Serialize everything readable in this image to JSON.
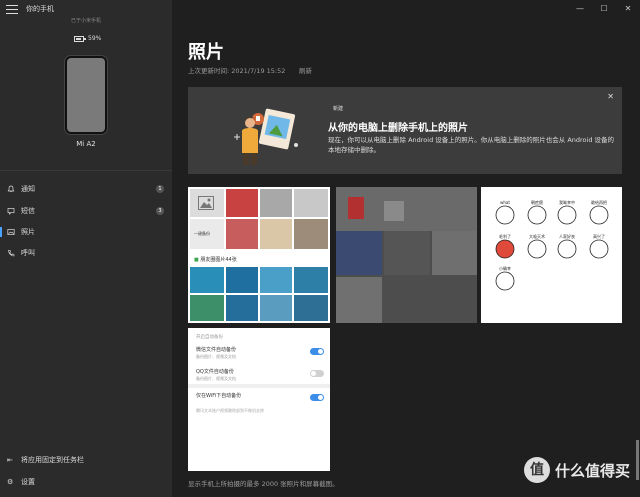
{
  "sidebar": {
    "app_title": "你的手机",
    "connected_text": "已于小米手机",
    "battery": {
      "percent_label": "59%",
      "level": 0.59
    },
    "phone_name": "Mi A2",
    "nav": [
      {
        "label": "通知",
        "icon": "bell-icon",
        "badge": "1"
      },
      {
        "label": "短信",
        "icon": "message-icon",
        "badge": "3"
      },
      {
        "label": "照片",
        "icon": "photo-icon",
        "badge": ""
      },
      {
        "label": "呼叫",
        "icon": "phone-call-icon",
        "badge": ""
      }
    ],
    "pin_taskbar": "将应用固定到任务栏",
    "settings": "设置"
  },
  "main": {
    "title": "照片",
    "last_update": "上次更新时间: 2021/7/19 15:52",
    "refresh": "刷新",
    "banner": {
      "tag": "新建",
      "title": "从你的电脑上删除手机上的照片",
      "desc": "现在，你可以从电脑上删除 Android 设备上的照片。你从电脑上删除的照片也会从 Android 设备的本地存储中删除。"
    },
    "photo1": {
      "album_label": "朋友圈图片44张",
      "sticker_text": "一键备份"
    },
    "photo3": {
      "sticker_labels": [
        "what",
        "朝疙瘩",
        "我呦幸中",
        "敢给再把",
        "毛利了",
        "大吸灭术",
        "人家好丧",
        "高兴了",
        "小确幸"
      ]
    },
    "photo4": {
      "section": "开启自动备份",
      "rows": [
        {
          "title": "微信文件自动备份",
          "sub": "备份图片、视频及文档",
          "on": true
        },
        {
          "title": "QQ文件自动备份",
          "sub": "备份图片、视频及文档",
          "on": false
        },
        {
          "title": "仅在WiFi下自动备份",
          "sub": "",
          "on": true
        }
      ],
      "note": "腾讯文本账户视频删除部到不做机去除"
    },
    "footer_note": "显示手机上所拍摄的最多 2000 张照片和屏幕截图。"
  },
  "watermark": {
    "badge": "值",
    "text": "什么值得买"
  },
  "colors": {
    "accent": "#4aa3ff",
    "sidebar_bg": "#2b2b2b",
    "main_bg": "#1f1f1f",
    "banner_bg": "#3c3c3c"
  }
}
